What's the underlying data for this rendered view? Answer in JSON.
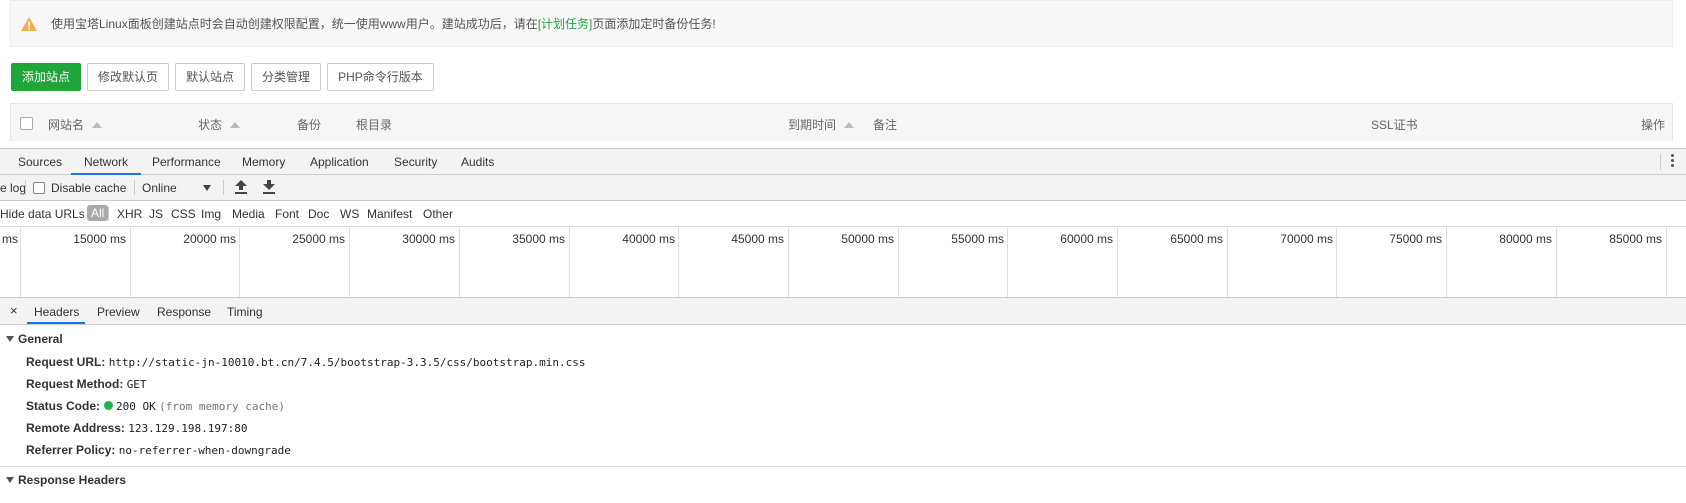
{
  "page": {
    "notice": {
      "text_before": "使用宝塔Linux面板创建站点时会自动创建权限配置，统一使用www用户。建站成功后，请在",
      "link": "[计划任务]",
      "text_after": "页面添加定时备份任务!",
      "icon": "warning-icon",
      "icon_color": "#f0ad4e"
    },
    "buttons": {
      "add_site": "添加站点",
      "edit_default_page": "修改默认页",
      "default_site": "默认站点",
      "category_manage": "分类管理",
      "php_cli_version": "PHP命令行版本"
    },
    "table_headers": {
      "site_name": "网站名",
      "status": "状态",
      "backup": "备份",
      "root_dir": "根目录",
      "expiry": "到期时间",
      "remark": "备注",
      "ssl": "SSL证书",
      "actions": "操作"
    },
    "accent_color": "#20a53a"
  },
  "devtools": {
    "tabs": [
      "Sources",
      "Network",
      "Performance",
      "Memory",
      "Application",
      "Security",
      "Audits"
    ],
    "active_tab": "Network",
    "toolbar": {
      "preserve_log": "e log",
      "disable_cache": "Disable cache",
      "throttling": "Online",
      "import_icon": "upload-icon",
      "export_icon": "download-icon"
    },
    "filter": {
      "hide_data_urls": "Hide data URLs",
      "types": [
        "All",
        "XHR",
        "JS",
        "CSS",
        "Img",
        "Media",
        "Font",
        "Doc",
        "WS",
        "Manifest",
        "Other"
      ]
    },
    "timeline": {
      "first_label": "ms",
      "ticks": [
        "15000 ms",
        "20000 ms",
        "25000 ms",
        "30000 ms",
        "35000 ms",
        "40000 ms",
        "45000 ms",
        "50000 ms",
        "55000 ms",
        "60000 ms",
        "65000 ms",
        "70000 ms",
        "75000 ms",
        "80000 ms",
        "85000 ms"
      ]
    },
    "detail_tabs": [
      "Headers",
      "Preview",
      "Response",
      "Timing"
    ],
    "active_detail_tab": "Headers",
    "general": {
      "title": "General",
      "request_url_label": "Request URL:",
      "request_url": "http://static-jn-10010.bt.cn/7.4.5/bootstrap-3.3.5/css/bootstrap.min.css",
      "request_method_label": "Request Method:",
      "request_method": "GET",
      "status_code_label": "Status Code:",
      "status_code": "200 OK",
      "status_note": "(from memory cache)",
      "remote_address_label": "Remote Address:",
      "remote_address": "123.129.198.197:80",
      "referrer_policy_label": "Referrer Policy:",
      "referrer_policy": "no-referrer-when-downgrade"
    },
    "response_headers_title": "Response Headers",
    "status_ok_color": "#22b24c",
    "tab_highlight_color": "#1a73e8"
  }
}
